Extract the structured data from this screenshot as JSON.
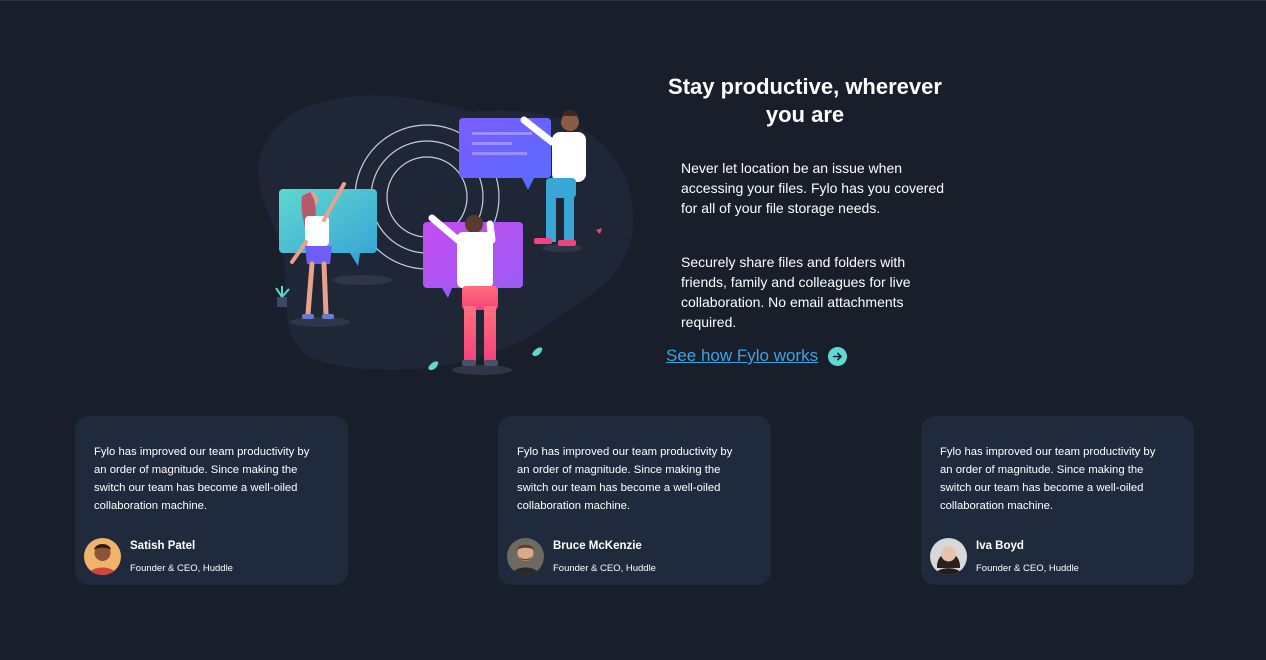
{
  "colors": {
    "background": "#181e2a",
    "card_background": "#202a3d",
    "link": "#3ca4e0",
    "accent_cyan": "#61d9d2"
  },
  "productive": {
    "headline": "Stay productive, wherever you are",
    "paragraph_1": "Never let location be an issue when accessing your files. Fylo has you covered for all of your file storage needs.",
    "paragraph_2": "Securely share files and folders with friends, family and colleagues for live collaboration. No email attachments required.",
    "cta_label": "See how Fylo works",
    "cta_icon": "arrow-right-circle-icon"
  },
  "testimonials": [
    {
      "quote": "Fylo has improved our team productivity by an order of magnitude. Since making the switch our team has become a well-oiled collaboration machine.",
      "name": "Satish Patel",
      "role": "Founder & CEO, Huddle"
    },
    {
      "quote": "Fylo has improved our team productivity by an order of magnitude. Since making the switch our team has become a well-oiled collaboration machine.",
      "name": "Bruce McKenzie",
      "role": "Founder & CEO, Huddle"
    },
    {
      "quote": "Fylo has improved our team productivity by an order of magnitude. Since making the switch our team has become a well-oiled collaboration machine.",
      "name": "Iva Boyd",
      "role": "Founder & CEO, Huddle"
    }
  ]
}
